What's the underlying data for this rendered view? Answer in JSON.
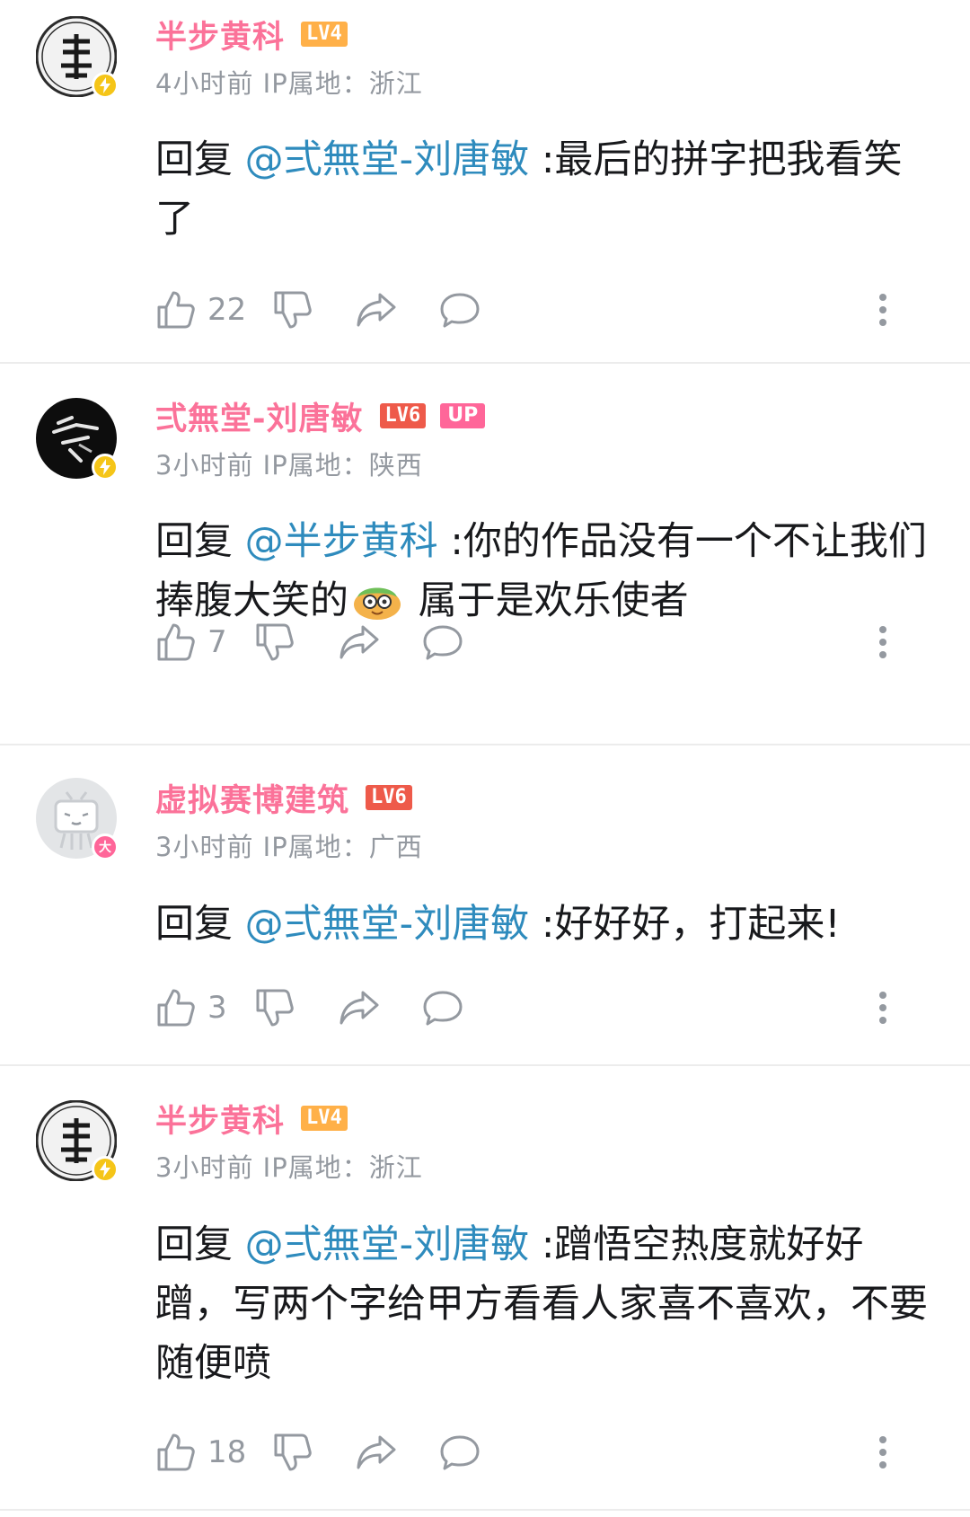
{
  "colors": {
    "username": "#fb7299",
    "mention": "#2e8bbd",
    "meta": "#9499a0",
    "lv4": "#ffb048",
    "lv6": "#ee5a4a",
    "up": "#ff6699"
  },
  "comments": [
    {
      "username": "半步黄科",
      "level": "LV4",
      "time": "4小时前",
      "ip": "IP属地：浙江",
      "reply_prefix": "回复 ",
      "mention": "@弍無堂-刘唐敏",
      "text": " :最后的拼字把我看笑了",
      "likes": "22"
    },
    {
      "username": "弍無堂-刘唐敏",
      "level": "LV6",
      "tag": "UP",
      "time": "3小时前",
      "ip": "IP属地：陕西",
      "reply_prefix": "回复 ",
      "mention": "@半步黄科",
      "text": " :你的作品没有一个不让我们捧腹大笑的",
      "text_after_emoji": " 属于是欢乐使者",
      "emoji": "laughing-emoji",
      "likes": "7"
    },
    {
      "username": "虚拟赛博建筑",
      "level": "LV6",
      "time": "3小时前",
      "ip": "IP属地：广西",
      "reply_prefix": "回复 ",
      "mention": "@弍無堂-刘唐敏",
      "text": " :好好好，打起来!",
      "likes": "3"
    },
    {
      "username": "半步黄科",
      "level": "LV4",
      "time": "3小时前",
      "ip": "IP属地：浙江",
      "reply_prefix": "回复 ",
      "mention": "@弍無堂-刘唐敏",
      "text": " :蹭悟空热度就好好蹭，写两个字给甲方看看人家喜不喜欢，不要随便喷",
      "likes": "18"
    }
  ],
  "badges": {
    "big_member": "大"
  }
}
